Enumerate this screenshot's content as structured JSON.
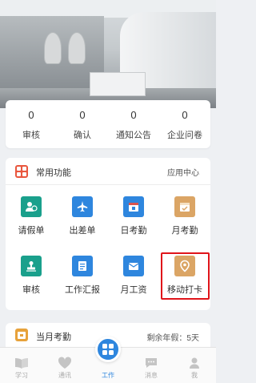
{
  "banner": {
    "slides": 3,
    "active_slide": 2
  },
  "stats": [
    {
      "count": "0",
      "label": "审核"
    },
    {
      "count": "0",
      "label": "确认"
    },
    {
      "count": "0",
      "label": "通知公告"
    },
    {
      "count": "0",
      "label": "企业问卷"
    }
  ],
  "common": {
    "title": "常用功能",
    "link": "应用中心",
    "items": [
      {
        "label": "请假单",
        "icon": "leave-request-icon",
        "color": "#1aa08c"
      },
      {
        "label": "出差单",
        "icon": "airplane-icon",
        "color": "#2e86de"
      },
      {
        "label": "日考勤",
        "icon": "calendar-day-icon",
        "color": "#2e86de"
      },
      {
        "label": "月考勤",
        "icon": "calendar-month-icon",
        "color": "#dba565"
      },
      {
        "label": "审核",
        "icon": "stamp-icon",
        "color": "#1aa08c"
      },
      {
        "label": "工作汇报",
        "icon": "report-icon",
        "color": "#2e86de"
      },
      {
        "label": "月工资",
        "icon": "salary-envelope-icon",
        "color": "#2e86de"
      },
      {
        "label": "移动打卡",
        "icon": "location-pin-icon",
        "color": "#dba565"
      }
    ]
  },
  "attendance": {
    "title": "当月考勤",
    "leave_balance": "剩余年假：5天"
  },
  "tabs": [
    {
      "label": "学习",
      "active": false
    },
    {
      "label": "通讯",
      "active": false
    },
    {
      "label": "工作",
      "active": true
    },
    {
      "label": "消息",
      "active": false
    },
    {
      "label": "我",
      "active": false
    }
  ],
  "colors": {
    "accent": "#2e86de",
    "teal": "#1aa08c",
    "gold": "#dba565",
    "highlight": "#e0141a"
  }
}
